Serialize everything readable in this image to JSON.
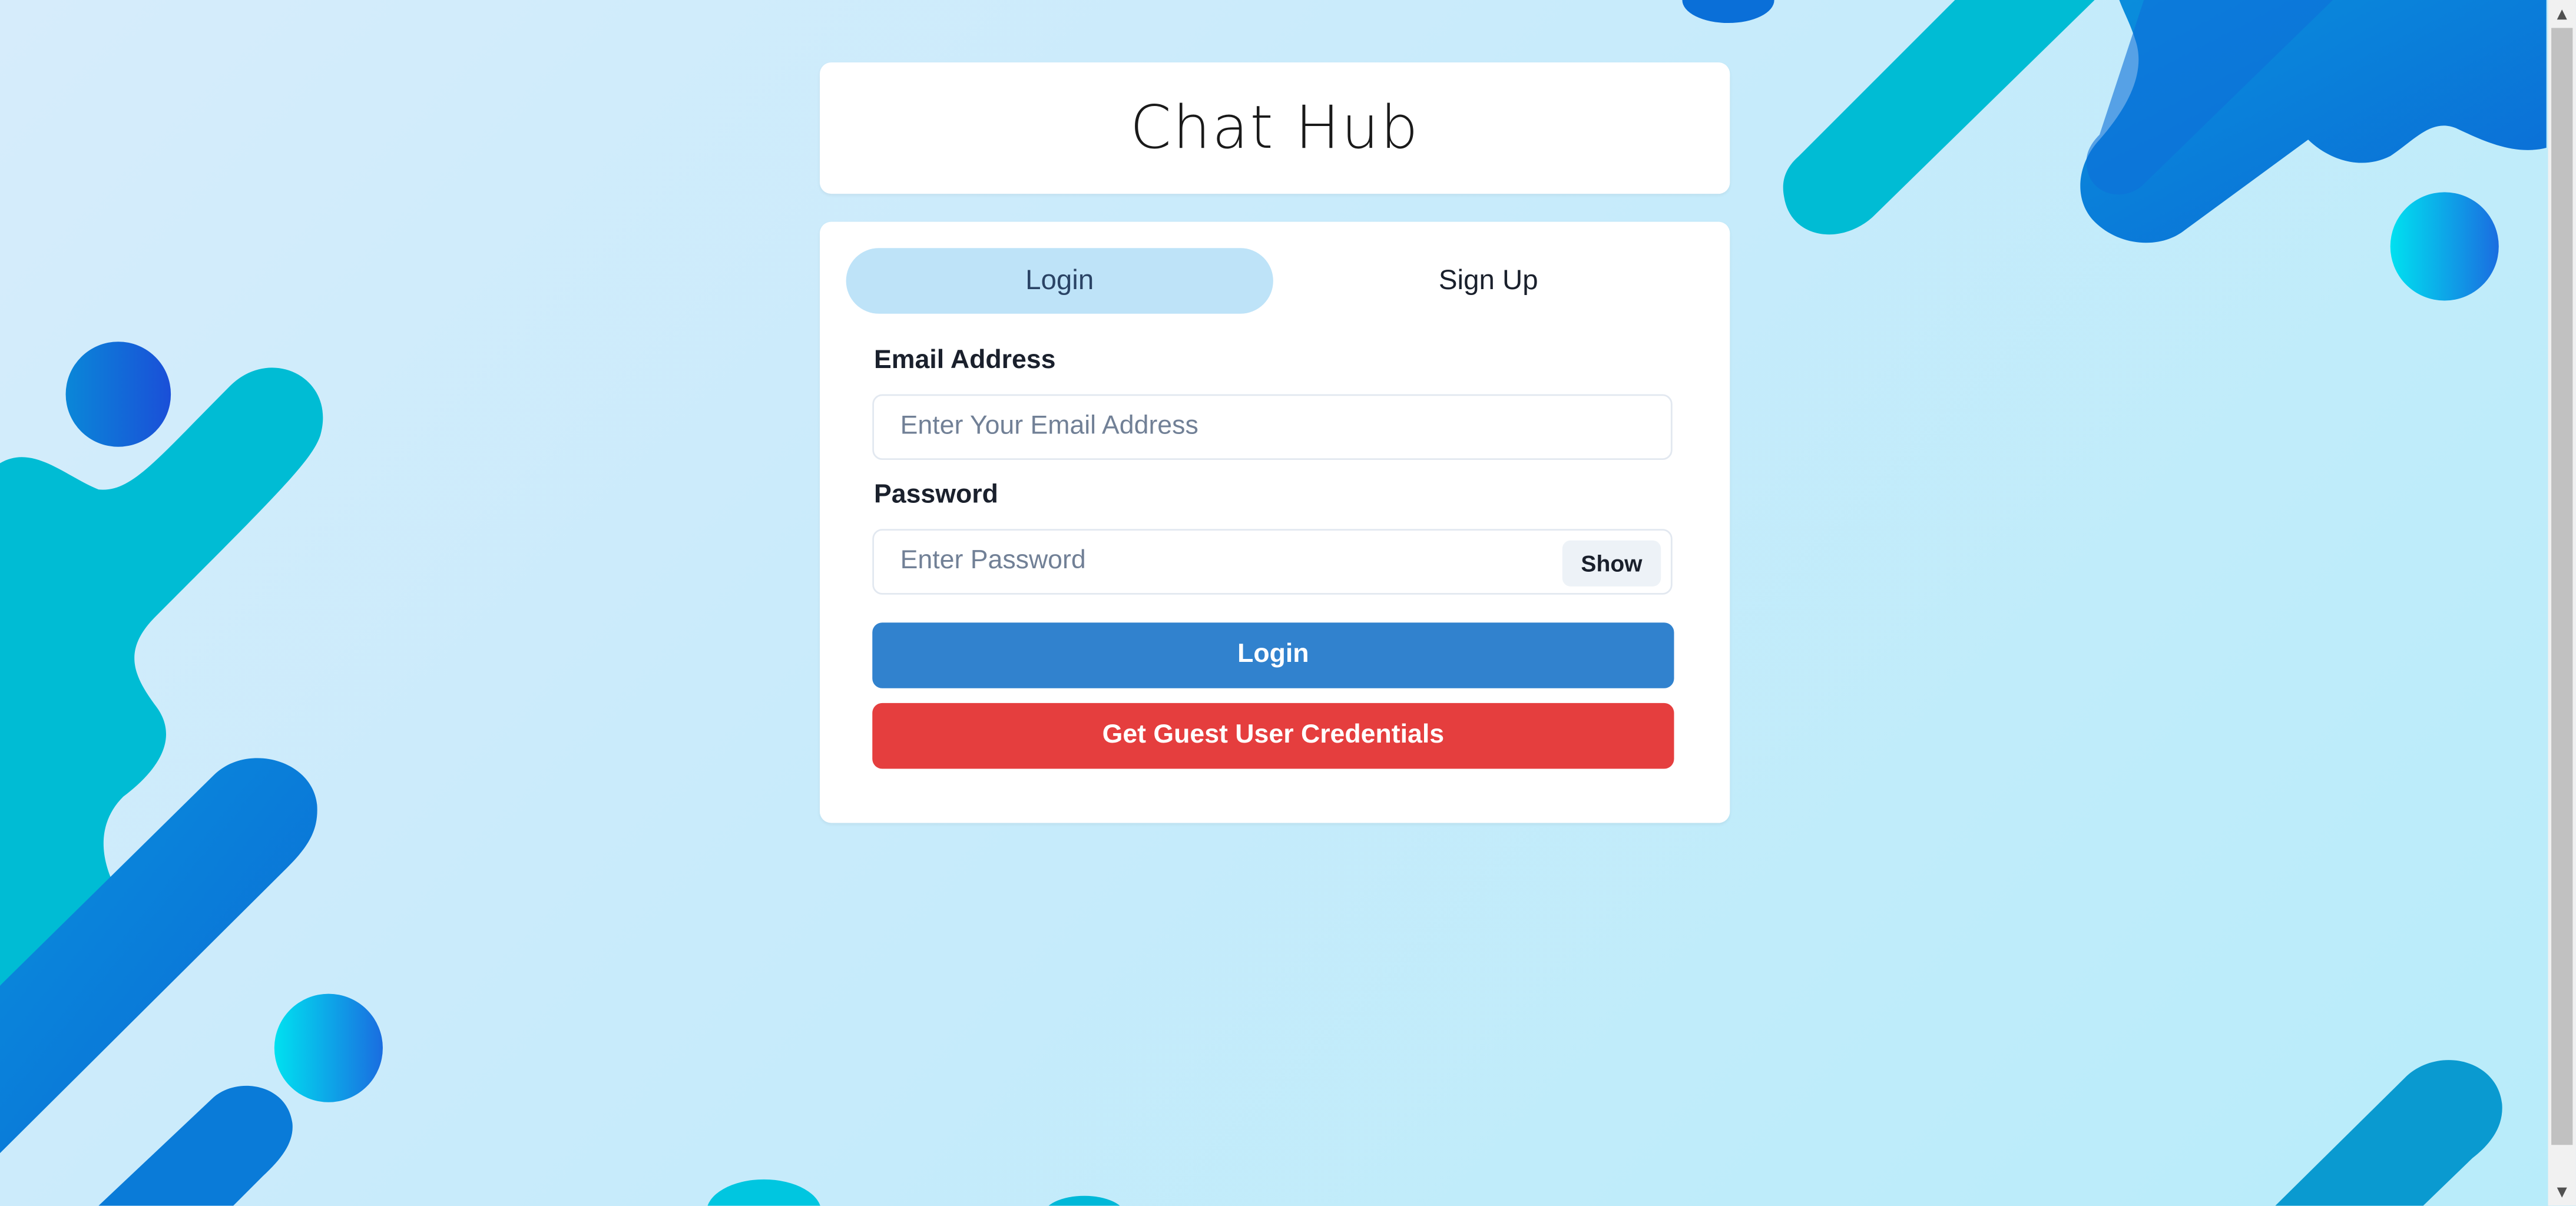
{
  "app": {
    "title": "Chat Hub"
  },
  "tabs": {
    "login_label": "Login",
    "signup_label": "Sign Up",
    "active": "Login"
  },
  "form": {
    "email_label": "Email Address",
    "email_placeholder": "Enter Your Email Address",
    "email_value": "",
    "password_label": "Password",
    "password_placeholder": "Enter Password",
    "password_value": "",
    "show_label": "Show",
    "login_button_label": "Login",
    "guest_button_label": "Get Guest User Credentials"
  },
  "colors": {
    "active_tab_bg": "#bee3f8",
    "login_button": "#3182ce",
    "guest_button": "#e53e3e",
    "background_teal": "#00bcd4",
    "background_blue": "#1e7fd8"
  },
  "scrollbar": {
    "up_icon": "triangle-up-icon",
    "down_icon": "triangle-down-icon"
  }
}
